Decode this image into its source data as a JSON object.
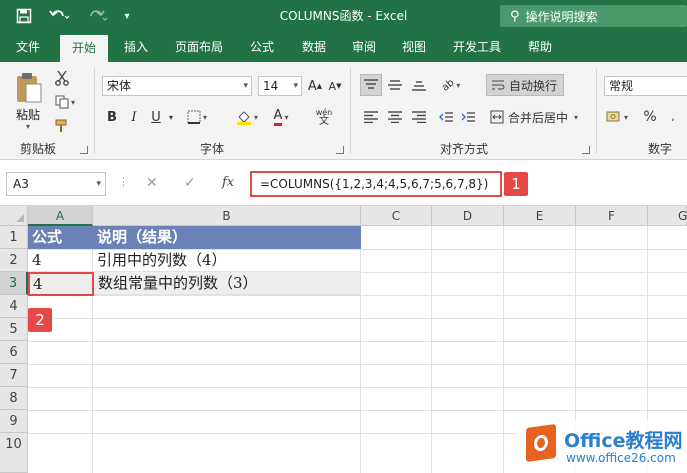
{
  "window": {
    "title": "COLUMNS函数  -  Excel",
    "tell_me": "操作说明搜索",
    "qat": {
      "save_icon": "save-icon",
      "undo_icon": "undo-icon",
      "redo_icon": "redo-icon",
      "customize_icon": "customize-qat-icon"
    }
  },
  "tabs": [
    {
      "label": "文件"
    },
    {
      "label": "开始"
    },
    {
      "label": "插入"
    },
    {
      "label": "页面布局"
    },
    {
      "label": "公式"
    },
    {
      "label": "数据"
    },
    {
      "label": "审阅"
    },
    {
      "label": "视图"
    },
    {
      "label": "开发工具"
    },
    {
      "label": "帮助"
    }
  ],
  "ribbon": {
    "clipboard": {
      "paste_label": "粘贴",
      "group_label": "剪贴板"
    },
    "font": {
      "family": "宋体",
      "size": "14",
      "bold": "B",
      "italic": "I",
      "underline": "U",
      "font_color": "A",
      "phonetic": "wén",
      "group_label": "字体"
    },
    "alignment": {
      "wrap_text": "自动换行",
      "merge_center": "合并后居中",
      "group_label": "对齐方式"
    },
    "number": {
      "format": "常规",
      "percent": "%",
      "group_label": "数字"
    }
  },
  "formula_bar": {
    "name_box": "A3",
    "fx_label": "fx",
    "formula": "=COLUMNS({1,2,3,4;4,5,6,7;5,6,7,8})"
  },
  "callouts": [
    "1",
    "2"
  ],
  "columns": [
    "A",
    "B",
    "C",
    "D",
    "E",
    "F",
    "G"
  ],
  "rows": [
    "1",
    "2",
    "3",
    "4",
    "5",
    "6",
    "7",
    "8",
    "9",
    "10"
  ],
  "cells": {
    "A1": "公式",
    "B1": "说明（结果）",
    "A2": "4",
    "B2": "引用中的列数（4）",
    "A3": "4",
    "B3": "数组常量中的列数（3）"
  },
  "watermark": {
    "title": "Office教程网",
    "url": "www.office26.com"
  },
  "colors": {
    "excel_green": "#217346",
    "header_fill": "#6b82b7",
    "highlight_red": "#e64848"
  }
}
